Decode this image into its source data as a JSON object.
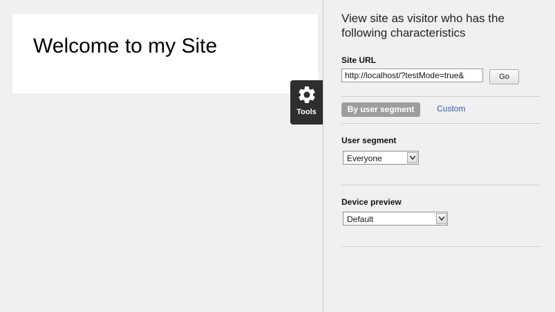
{
  "site": {
    "welcome_title": "Welcome to my Site"
  },
  "tools": {
    "label": "Tools",
    "icon": "gear-icon"
  },
  "panel": {
    "heading": "View site as visitor who has the following characteristics",
    "site_url": {
      "label": "Site URL",
      "value": "http://localhost/?testMode=true&",
      "go_label": "Go"
    },
    "tabs": [
      {
        "label": "By user segment",
        "active": true
      },
      {
        "label": "Custom",
        "active": false
      }
    ],
    "user_segment": {
      "label": "User segment",
      "selected": "Everyone"
    },
    "device_preview": {
      "label": "Device preview",
      "selected": "Default"
    }
  },
  "colors": {
    "tools_bg": "#2e2e2e",
    "tab_active_bg": "#9e9e9e",
    "link": "#2a5db0",
    "page_bg": "#f0f0f0"
  }
}
